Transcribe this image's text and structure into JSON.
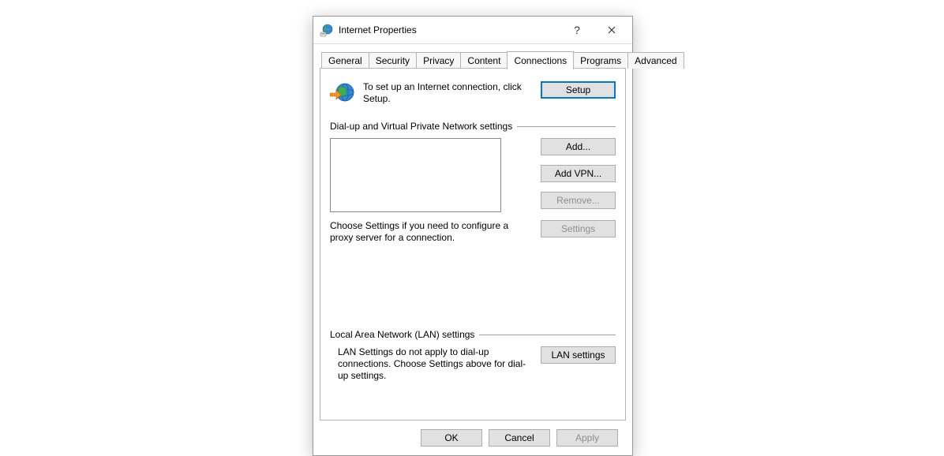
{
  "window": {
    "title": "Internet Properties"
  },
  "tabs": {
    "general": "General",
    "security": "Security",
    "privacy": "Privacy",
    "content": "Content",
    "connections": "Connections",
    "programs": "Programs",
    "advanced": "Advanced"
  },
  "intro": {
    "text": "To set up an Internet connection, click Setup.",
    "setup_btn": "Setup"
  },
  "dialup": {
    "section_label": "Dial-up and Virtual Private Network settings",
    "add_btn": "Add...",
    "add_vpn_btn": "Add VPN...",
    "remove_btn": "Remove...",
    "settings_btn": "Settings",
    "choose_text": "Choose Settings if you need to configure a proxy server for a connection."
  },
  "lan": {
    "section_label": "Local Area Network (LAN) settings",
    "text": "LAN Settings do not apply to dial-up connections. Choose Settings above for dial-up settings.",
    "btn": "LAN settings"
  },
  "footer": {
    "ok": "OK",
    "cancel": "Cancel",
    "apply": "Apply"
  }
}
